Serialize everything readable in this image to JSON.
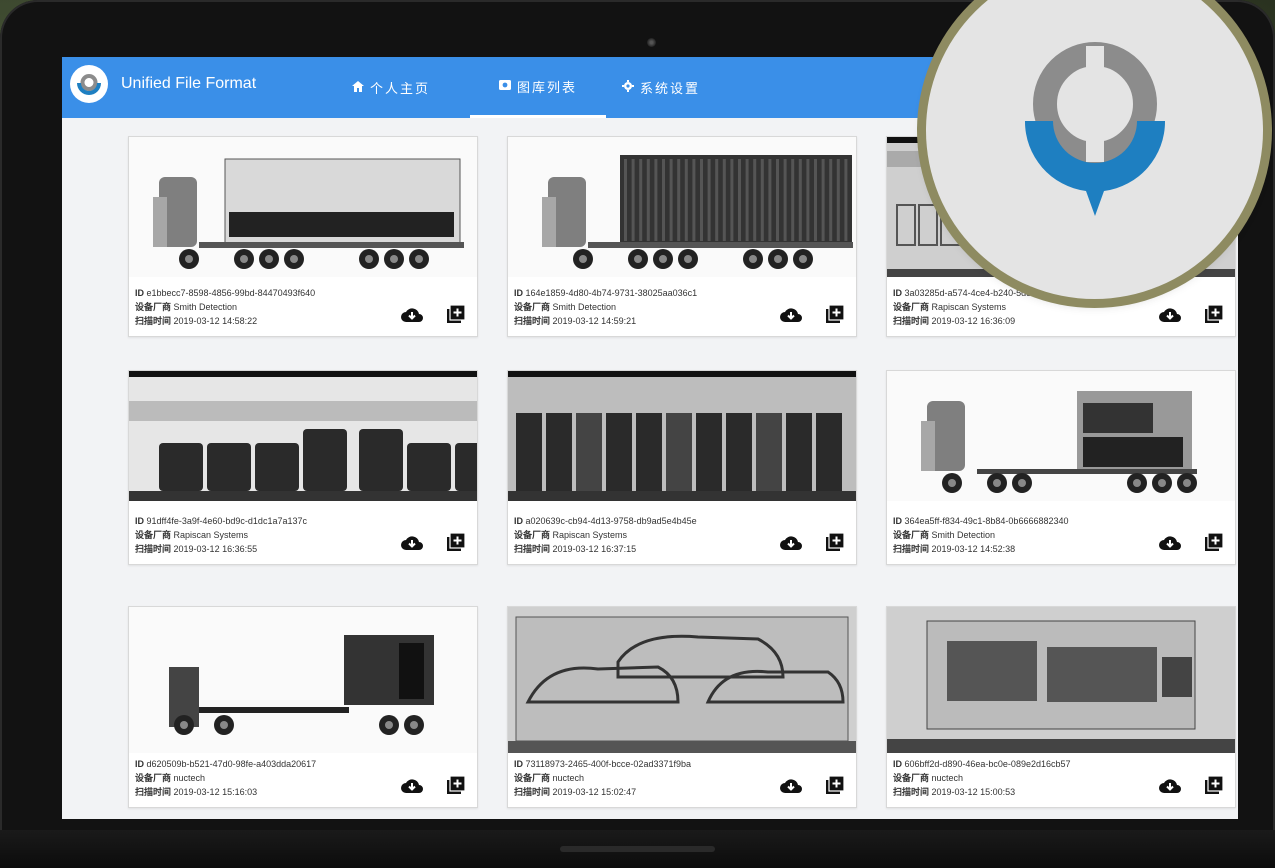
{
  "app": {
    "title": "Unified File Format"
  },
  "nav": [
    {
      "label": "个人主页",
      "icon": "home-icon",
      "active": false
    },
    {
      "label": "图库列表",
      "icon": "gallery-icon",
      "active": true
    },
    {
      "label": "系统设置",
      "icon": "gear-icon",
      "active": false
    }
  ],
  "labels": {
    "id": "ID",
    "vendor": "设备厂商",
    "scan_time": "扫描时间"
  },
  "colors": {
    "appbar": "#3a8fe8",
    "badge_ring": "#8e8b61",
    "logo_blue": "#1e7fc1",
    "logo_gray": "#8c8c8c"
  },
  "cards": [
    {
      "id": "e1bbecc7-8598-4856-99bd-84470493f640",
      "vendor": "Smith Detection",
      "scan_time": "2019-03-12 14:58:22",
      "image": "truck-cab-box-trailer"
    },
    {
      "id": "164e1859-4d80-4b74-9731-38025aa036c1",
      "vendor": "Smith Detection",
      "scan_time": "2019-03-12 14:59:21",
      "image": "truck-cab-dense-container"
    },
    {
      "id": "3a03285d-a574-4ce4-b240-5d89eb8b10b7",
      "vendor": "Rapiscan Systems",
      "scan_time": "2019-03-12 16:36:09",
      "image": "container-crates"
    },
    {
      "id": "91dff4fe-3a9f-4e60-bd9c-d1dc1a7a137c",
      "vendor": "Rapiscan Systems",
      "scan_time": "2019-03-12 16:36:55",
      "image": "container-barrels"
    },
    {
      "id": "a020639c-cb94-4d13-9758-db9ad5e4b45e",
      "vendor": "Rapiscan Systems",
      "scan_time": "2019-03-12 16:37:15",
      "image": "container-dark-cargo"
    },
    {
      "id": "364ea5ff-f834-49c1-8b84-0b6666882340",
      "vendor": "Smith Detection",
      "scan_time": "2019-03-12 14:52:38",
      "image": "truck-cab-flatbed-container"
    },
    {
      "id": "d620509b-b521-47d0-98fe-a403dda20617",
      "vendor": "nuctech",
      "scan_time": "2019-03-12 15:16:03",
      "image": "truck-flatbed-trailer"
    },
    {
      "id": "73118973-2465-400f-bcce-02ad3371f9ba",
      "vendor": "nuctech",
      "scan_time": "2019-03-12 15:02:47",
      "image": "container-vehicles"
    },
    {
      "id": "606bff2d-d890-46ea-bc0e-089e2d16cb57",
      "vendor": "nuctech",
      "scan_time": "2019-03-12 15:00:53",
      "image": "container-machinery"
    }
  ]
}
